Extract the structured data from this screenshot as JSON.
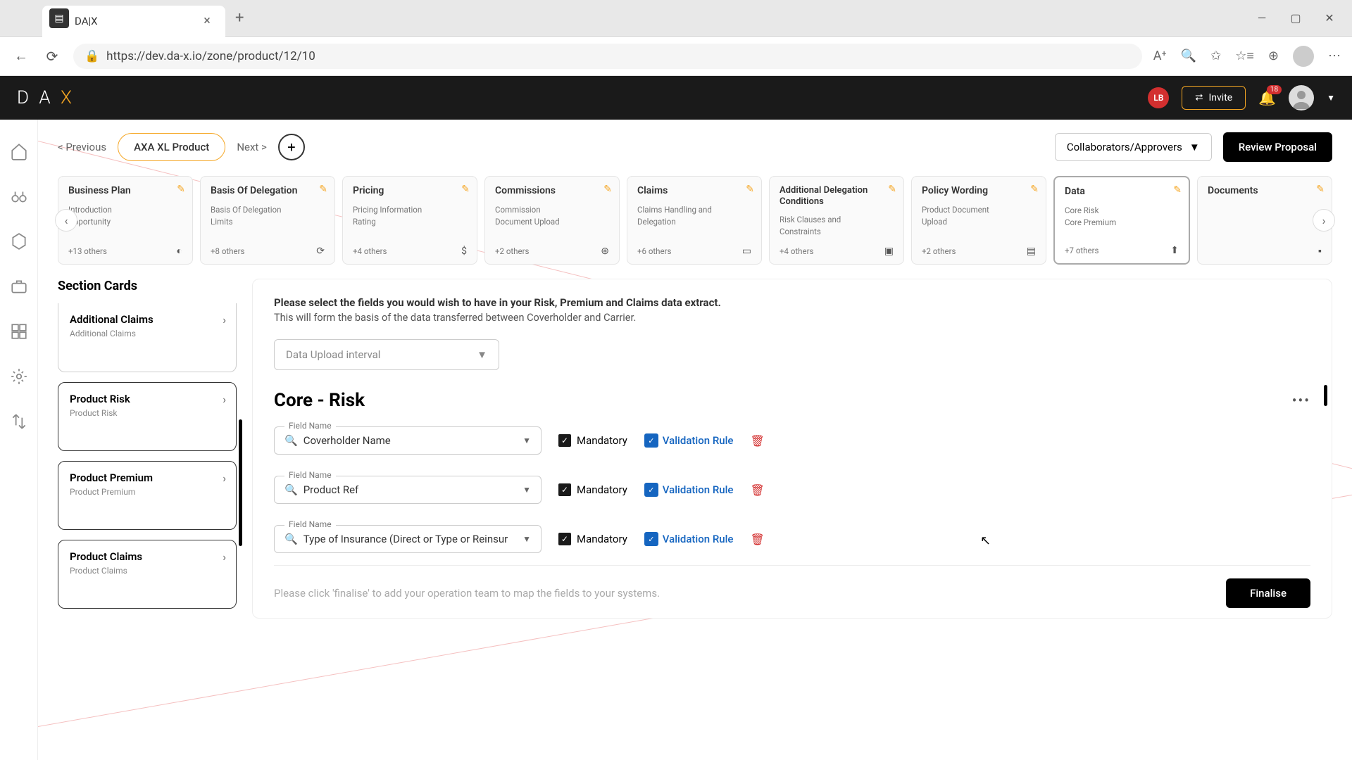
{
  "browser": {
    "tab_title": "DA|X",
    "url_display": "https://dev.da-x.io/zone/product/12/10",
    "favicon_letter": "A"
  },
  "header": {
    "logo_parts": [
      "D",
      "A",
      "X"
    ],
    "badge_initials": "LB",
    "invite_label": "Invite",
    "notification_count": "18"
  },
  "top_controls": {
    "previous": "< Previous",
    "product_name": "AXA XL Product",
    "next": "Next >",
    "collaborators": "Collaborators/Approvers",
    "review": "Review Proposal"
  },
  "carousel": [
    {
      "title": "Business Plan",
      "lines": [
        "Introduction",
        "Opportunity"
      ],
      "others": "+13 others",
      "icon": "◐"
    },
    {
      "title": "Basis Of Delegation",
      "lines": [
        "Basis Of Delegation",
        "Limits"
      ],
      "others": "+8 others",
      "icon": "⟳"
    },
    {
      "title": "Pricing",
      "lines": [
        "Pricing Information",
        "Rating"
      ],
      "others": "+4 others",
      "icon": "$"
    },
    {
      "title": "Commissions",
      "lines": [
        "Commission",
        "Document Upload"
      ],
      "others": "+2 others",
      "icon": "⊛"
    },
    {
      "title": "Claims",
      "lines": [
        "Claims Handling and",
        "Delegation"
      ],
      "others": "+6 others",
      "icon": "▭"
    },
    {
      "title": "Additional Delegation Conditions",
      "lines": [
        "Risk Clauses and",
        "Constraints"
      ],
      "others": "+4 others",
      "icon": "▣"
    },
    {
      "title": "Policy Wording",
      "lines": [
        "Product Document",
        "Upload"
      ],
      "others": "+2 others",
      "icon": "▤"
    },
    {
      "title": "Data",
      "lines": [
        "Core Risk",
        "Core Premium"
      ],
      "others": "+7 others",
      "icon": "⬆",
      "active": true
    },
    {
      "title": "Documents",
      "lines": [
        "",
        ""
      ],
      "others": "",
      "icon": "▪"
    }
  ],
  "section_panel": {
    "heading": "Section Cards",
    "cards": [
      {
        "title": "Additional Claims",
        "sub": "Additional Claims"
      },
      {
        "title": "Product Risk",
        "sub": "Product Risk"
      },
      {
        "title": "Product Premium",
        "sub": "Product Premium"
      },
      {
        "title": "Product Claims",
        "sub": "Product Claims"
      }
    ]
  },
  "form": {
    "intro_bold": "Please select the fields you would wish to have in your Risk, Premium and Claims data extract.",
    "intro_sub": "This will form the basis of the data transferred between Coverholder and Carrier.",
    "interval_placeholder": "Data Upload interval",
    "section_title": "Core - Risk",
    "field_label": "Field Name",
    "mandatory_label": "Mandatory",
    "validation_label": "Validation Rule",
    "rows": [
      {
        "value": "Coverholder Name"
      },
      {
        "value": "Product Ref"
      },
      {
        "value": "Type of Insurance (Direct or Type or Reinsur"
      }
    ],
    "finalise_hint": "Please click 'finalise' to add your operation team to map the fields to your systems.",
    "finalise_label": "Finalise"
  }
}
